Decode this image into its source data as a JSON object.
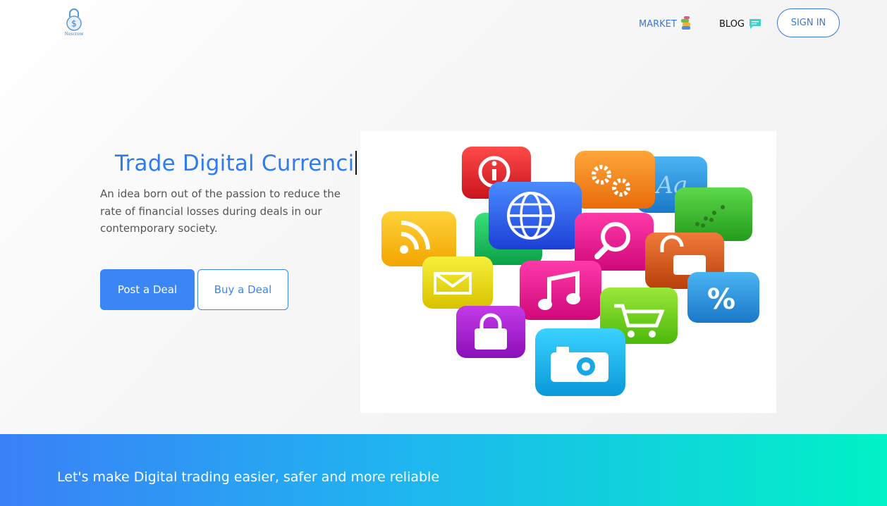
{
  "header": {
    "logo_text": "Nescrow",
    "nav": {
      "market_label": "MARKET",
      "blog_label": "BLOG",
      "signin_label": "SIGN IN"
    }
  },
  "hero": {
    "headline": "Trade Digital Currenci",
    "tagline": "An idea born out of the passion to reduce the rate of financial losses during deals in our contemporary society.",
    "post_button": "Post a Deal",
    "buy_button": "Buy a Deal",
    "illustration_icons": [
      "info-icon",
      "gear-icon",
      "font-icon",
      "globe-icon",
      "rss-icon",
      "search-icon",
      "unlock-icon",
      "mail-icon",
      "music-icon",
      "percent-icon",
      "cart-icon",
      "lock-icon",
      "camera-icon",
      "chart-icon"
    ]
  },
  "banner": {
    "text": "Let's make Digital trading easier, safer and more reliable"
  },
  "colors": {
    "accent": "#3b86f5",
    "banner_start": "#3a80f7",
    "banner_end": "#00f2c6"
  }
}
